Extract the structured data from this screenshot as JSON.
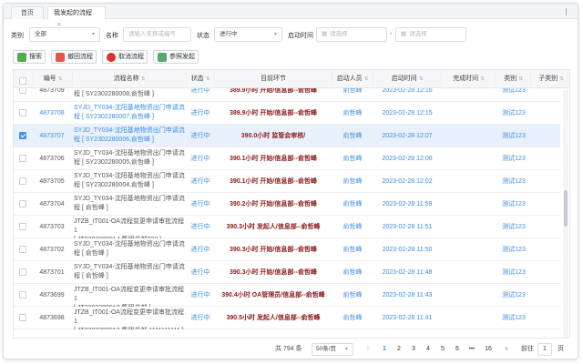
{
  "tabs": {
    "home": "首页",
    "current": "我发起的流程",
    "close": "×"
  },
  "filters": {
    "category_label": "类别",
    "category_value": "全部",
    "name_label": "名称",
    "name_placeholder": "请输入名称或编号",
    "status_label": "状态",
    "status_value": "进行中",
    "time_label": "启动时间",
    "from_placeholder": "请选择",
    "dash": "-",
    "to_placeholder": "请选择"
  },
  "toolbar": {
    "search": "搜索",
    "withdraw": "撤回流程",
    "cancel": "取消流程",
    "resubmit": "参照发起"
  },
  "columns": {
    "id": "编号",
    "name": "流程名称",
    "status": "状态",
    "node": "目前环节",
    "user": "启动人员",
    "start": "启动时间",
    "end": "完成时间",
    "category": "类别",
    "subcategory": "子类别"
  },
  "rows": [
    {
      "id": "4873709",
      "name1": "SYJD_TY034-沈阳基地物资出门申请流",
      "name2": "程 [ SY2302280008,俞哲峰 ]",
      "status": "进行中",
      "node": "389.9小时 开始/信息部--俞哲峰",
      "user": "俞哲峰",
      "start": "2023-02-28 12:16",
      "category": "测试123",
      "selected": false,
      "blue": false
    },
    {
      "id": "4873708",
      "name1": "SYJD_TY034-沈阳基地物资出门申请流",
      "name2": "程 [ SY2302280007,俞哲峰 ]",
      "status": "进行中",
      "node": "389.9小时 开始/信息部--俞哲峰",
      "user": "俞哲峰",
      "start": "2023-02-28 12:15",
      "category": "测试123",
      "selected": false,
      "blue": true
    },
    {
      "id": "4873707",
      "name1": "SYJD_TY034-沈阳基地物资出门申请流",
      "name2": "程 [ SY2302280006,俞哲峰 ]",
      "status": "进行中",
      "node": "390.0小时 监管会审核/",
      "user": "俞哲峰",
      "start": "2023-02-28 12:07",
      "category": "测试123",
      "selected": true,
      "blue": true
    },
    {
      "id": "4873706",
      "name1": "SYJD_TY034-沈阳基地物资出门申请流",
      "name2": "程 [ SY2302280005,俞哲峰 ]",
      "status": "进行中",
      "node": "390.1小时 开始/信息部--俞哲峰",
      "user": "俞哲峰",
      "start": "2023-02-28 12:06",
      "category": "测试123",
      "selected": false,
      "blue": false
    },
    {
      "id": "4873705",
      "name1": "SYJD_TY034-沈阳基地物资出门申请流",
      "name2": "程 [ SY2302280004,俞哲峰 ]",
      "status": "进行中",
      "node": "390.1小时 开始/信息部--俞哲峰",
      "user": "俞哲峰",
      "start": "2023-02-28 12:02",
      "category": "测试123",
      "selected": false,
      "blue": false
    },
    {
      "id": "4873704",
      "name1": "SYJD_TY034-沈阳基地物资出门申请流",
      "name2": "程 [ 俞哲峰 ]",
      "status": "进行中",
      "node": "390.2小时 开始/信息部--俞哲峰",
      "user": "俞哲峰",
      "start": "2023-02-28 11:59",
      "category": "测试123",
      "selected": false,
      "blue": false
    },
    {
      "id": "4873703",
      "name1": "JTZB_IT001-OA流程变更申请审批流程1",
      "name2": "[ JT2302280014,集团总部222 ]",
      "status": "进行中",
      "node": "390.3小时 发起人/信息部--俞哲峰",
      "user": "俞哲峰",
      "start": "2023-02-28 11:51",
      "category": "测试123",
      "selected": false,
      "blue": false
    },
    {
      "id": "4873702",
      "name1": "SYJD_TY034-沈阳基地物资出门申请流",
      "name2": "程 [ 俞哲峰 ]",
      "status": "进行中",
      "node": "390.3小时 开始/信息部--俞哲峰",
      "user": "俞哲峰",
      "start": "2023-02-28 11:50",
      "category": "测试123",
      "selected": false,
      "blue": false
    },
    {
      "id": "4873701",
      "name1": "SYJD_TY034-沈阳基地物资出门申请流",
      "name2": "程 [ 俞哲峰 ]",
      "status": "进行中",
      "node": "390.3小时 开始/信息部--俞哲峰",
      "user": "俞哲峰",
      "start": "2023-02-28 11:48",
      "category": "测试123",
      "selected": false,
      "blue": false
    },
    {
      "id": "4873699",
      "name1": "JTZB_IT001-OA流程变更申请审批流程1",
      "name2": "[ JT2302280013,集团总部 ]",
      "status": "进行中",
      "node": "390.4小时 OA管理员/信息部--俞哲峰",
      "user": "俞哲峰",
      "start": "2023-02-28 11:43",
      "category": "测试123",
      "selected": false,
      "blue": false
    },
    {
      "id": "4873698",
      "name1": "JTZB_IT001-OA流程变更申请审批流程1",
      "name2": "[ JT2302280012,集团总部 1111111111 ]",
      "status": "进行中",
      "node": "390.5小时 发起人/信息部--俞哲峰",
      "user": "俞哲峰",
      "start": "2023-02-28 11:41",
      "category": "测试123",
      "selected": false,
      "blue": false
    }
  ],
  "pager": {
    "total": "共 794 条",
    "size": "50条/页",
    "prev": "‹",
    "pages": [
      "1",
      "2",
      "3",
      "4",
      "5",
      "6",
      "•••",
      "16"
    ],
    "next": "›",
    "goto": "前往",
    "goto_value": "1",
    "page_unit": "页"
  },
  "colors": {
    "node": "#8b1a1a",
    "link": "#3b8be3",
    "selected_row": "#e8f1fb"
  },
  "icons": {
    "search": "search-icon",
    "withdraw": "undo-icon",
    "cancel": "cancel-icon",
    "resubmit": "copy-icon"
  }
}
